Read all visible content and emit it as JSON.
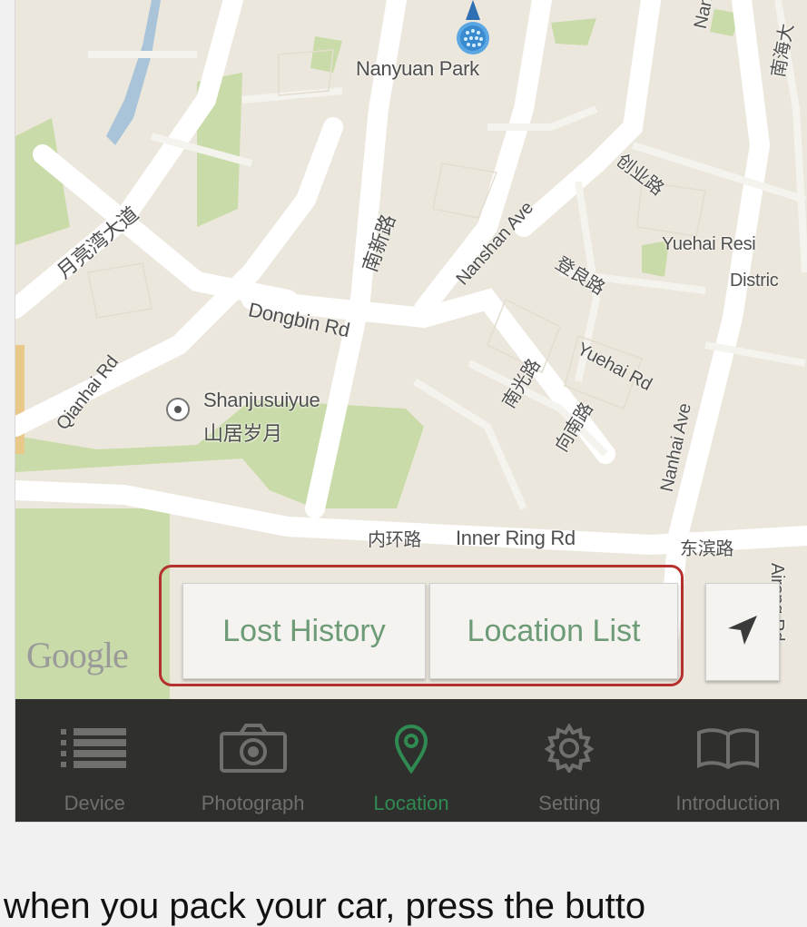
{
  "map": {
    "logo_text": "Google",
    "labels": {
      "nanyuan_park": "Nanyuan Park",
      "nanguang_rd": "Nanguang Rd",
      "nanhai_zh_top": "南海大",
      "chuangye_rd": "创业路",
      "yuehai_resi": "Yuehai Resi",
      "district": "Distric",
      "yuewan_ave": "月亮湾大道",
      "nanxin_rd": "南新路",
      "nanshan_ave": "Nanshan Ave",
      "dengliang_rd": "登良路",
      "dongbin_rd": "Dongbin Rd",
      "qianhai_rd": "Qianhai Rd",
      "nanguang_zh": "南光路",
      "yuehai_rd": "Yuehai Rd",
      "xiangnan_rd": "向南路",
      "nanhai_ave": "Nanhai Ave",
      "shanjusuiyue": "Shanjusuiyue",
      "shanjusuiyue_zh": "山居岁月",
      "inner_ring_zh": "内环路",
      "inner_ring": "Inner Ring Rd",
      "dongbin_zh": "东滨路",
      "airong_rd": "Airong Rd"
    }
  },
  "buttons": {
    "lost_history": "Lost History",
    "location_list": "Location List",
    "nav_icon": "navigation-arrow-icon"
  },
  "tabs": [
    {
      "label": "Device",
      "icon": "list-icon",
      "active": false
    },
    {
      "label": "Photograph",
      "icon": "camera-icon",
      "active": false
    },
    {
      "label": "Location",
      "icon": "location-pin-icon",
      "active": true
    },
    {
      "label": "Setting",
      "icon": "gear-icon",
      "active": false
    },
    {
      "label": "Introduction",
      "icon": "book-icon",
      "active": false
    }
  ],
  "caption": "when you pack your car, press the butto",
  "colors": {
    "highlight": "#b5312e",
    "button_text": "#6d9b77",
    "tab_active": "#2f8b52",
    "tab_bar": "#2f2f2d",
    "map_bg": "#ece7dc",
    "park_green": "#c9dba8"
  }
}
